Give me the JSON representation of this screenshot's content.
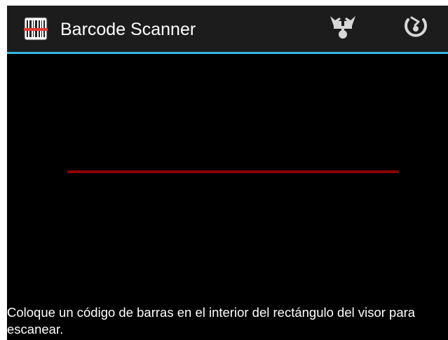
{
  "app": {
    "title": "Barcode Scanner",
    "icon": "barcode-icon",
    "accent_color": "#33b5e5"
  },
  "action_bar": {
    "actions": [
      {
        "name": "share",
        "icon": "share-icon"
      },
      {
        "name": "history",
        "icon": "history-icon"
      }
    ]
  },
  "viewfinder": {
    "laser_color": "#8a0000"
  },
  "status": {
    "text": "Coloque un código de barras en el interior del rectángulo del visor para escanear."
  }
}
